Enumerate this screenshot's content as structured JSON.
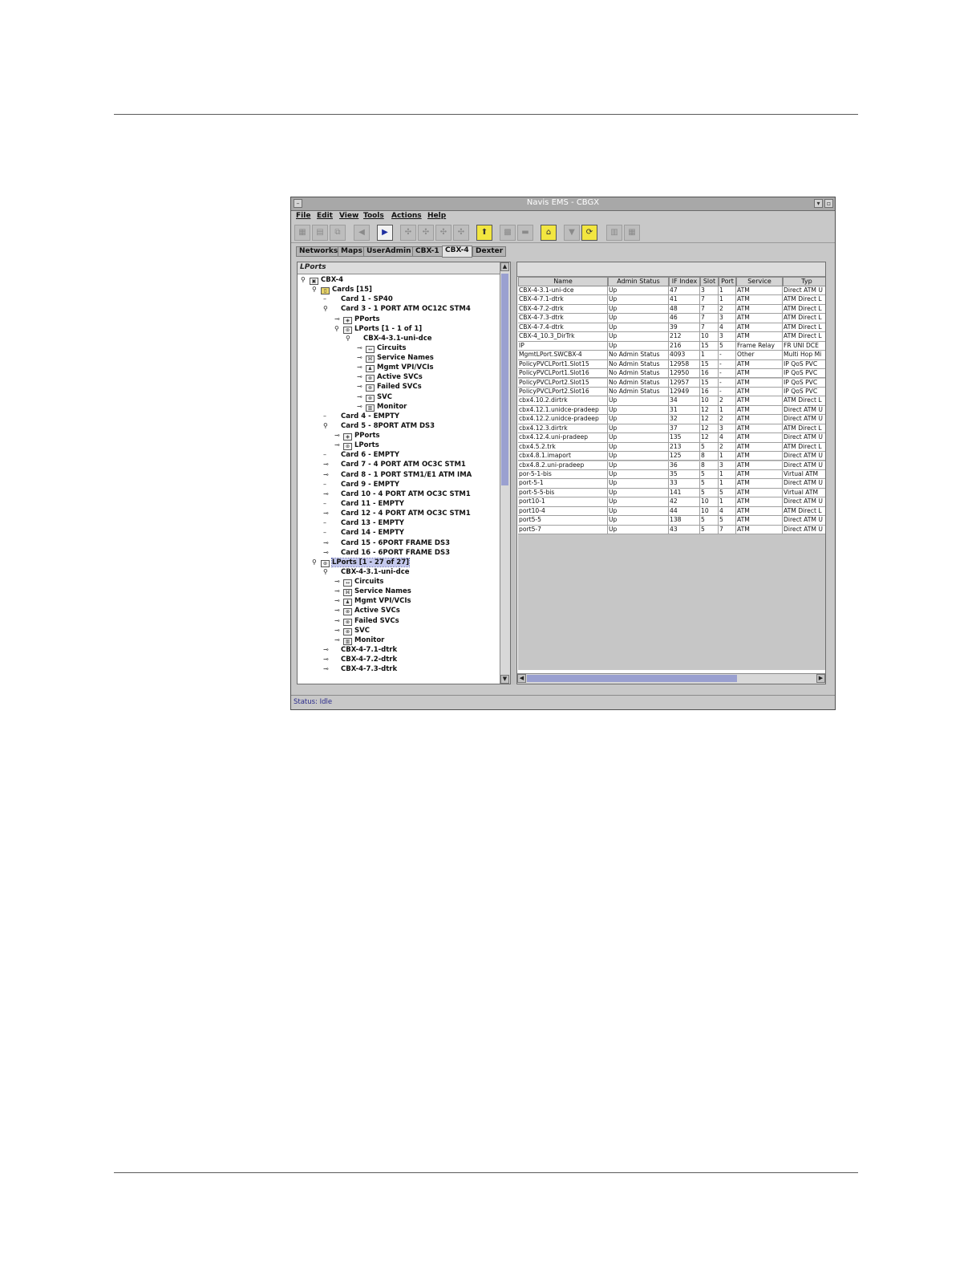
{
  "window": {
    "title": "Navis EMS - CBGX",
    "menu": [
      "File",
      "Edit",
      "View",
      "Tools",
      "Actions",
      "Help"
    ],
    "tabs": [
      "Networks",
      "Maps",
      "UserAdmin",
      "CBX-1",
      "CBX-4",
      "Dexter"
    ],
    "active_tab": "CBX-4",
    "status": "Status: Idle"
  },
  "tree": {
    "header": "LPorts",
    "nodes": [
      {
        "label": "CBX-4",
        "depth": 0,
        "exp": "⚲",
        "icon": "switch"
      },
      {
        "label": "Cards [15]",
        "depth": 1,
        "exp": "⚲",
        "icon": "card"
      },
      {
        "label": "Card 1 - SP40",
        "depth": 2,
        "exp": "–",
        "icon": "none"
      },
      {
        "label": "Card 3 - 1 PORT ATM OC12C STM4",
        "depth": 2,
        "exp": "⚲",
        "icon": "none"
      },
      {
        "label": "PPorts",
        "depth": 3,
        "exp": "⊸",
        "icon": "pport"
      },
      {
        "label": "LPorts [1 - 1 of 1]",
        "depth": 3,
        "exp": "⚲",
        "icon": "lport"
      },
      {
        "label": "CBX-4-3.1-uni-dce",
        "depth": 4,
        "exp": "⚲",
        "icon": "none"
      },
      {
        "label": "Circuits",
        "depth": 5,
        "exp": "⊸",
        "icon": "circuit"
      },
      {
        "label": "Service Names",
        "depth": 5,
        "exp": "⊸",
        "icon": "service"
      },
      {
        "label": "Mgmt VPI/VCIs",
        "depth": 5,
        "exp": "⊸",
        "icon": "mgmt"
      },
      {
        "label": "Active SVCs",
        "depth": 5,
        "exp": "⊸",
        "icon": "svc"
      },
      {
        "label": "Failed SVCs",
        "depth": 5,
        "exp": "⊸",
        "icon": "svc"
      },
      {
        "label": "SVC",
        "depth": 5,
        "exp": "⊸",
        "icon": "svc"
      },
      {
        "label": "Monitor",
        "depth": 5,
        "exp": "⊸",
        "icon": "monitor"
      },
      {
        "label": "Card 4 - EMPTY",
        "depth": 2,
        "exp": "–",
        "icon": "none"
      },
      {
        "label": "Card 5 - 8PORT ATM DS3",
        "depth": 2,
        "exp": "⚲",
        "icon": "none"
      },
      {
        "label": "PPorts",
        "depth": 3,
        "exp": "⊸",
        "icon": "pport"
      },
      {
        "label": "LPorts",
        "depth": 3,
        "exp": "⊸",
        "icon": "lport"
      },
      {
        "label": "Card 6 - EMPTY",
        "depth": 2,
        "exp": "–",
        "icon": "none"
      },
      {
        "label": "Card 7 - 4 PORT ATM OC3C STM1",
        "depth": 2,
        "exp": "⊸",
        "icon": "none"
      },
      {
        "label": "Card 8 - 1 PORT STM1/E1 ATM IMA",
        "depth": 2,
        "exp": "⊸",
        "icon": "none"
      },
      {
        "label": "Card 9 - EMPTY",
        "depth": 2,
        "exp": "–",
        "icon": "none"
      },
      {
        "label": "Card 10 - 4 PORT ATM OC3C STM1",
        "depth": 2,
        "exp": "⊸",
        "icon": "none"
      },
      {
        "label": "Card 11 - EMPTY",
        "depth": 2,
        "exp": "–",
        "icon": "none"
      },
      {
        "label": "Card 12 - 4 PORT ATM OC3C STM1",
        "depth": 2,
        "exp": "⊸",
        "icon": "none"
      },
      {
        "label": "Card 13 - EMPTY",
        "depth": 2,
        "exp": "–",
        "icon": "none"
      },
      {
        "label": "Card 14 - EMPTY",
        "depth": 2,
        "exp": "–",
        "icon": "none"
      },
      {
        "label": "Card 15 - 6PORT FRAME DS3",
        "depth": 2,
        "exp": "⊸",
        "icon": "none"
      },
      {
        "label": "Card 16 - 6PORT FRAME DS3",
        "depth": 2,
        "exp": "⊸",
        "icon": "none"
      },
      {
        "label": "LPorts [1 - 27 of 27]",
        "depth": 1,
        "exp": "⚲",
        "icon": "lport",
        "selected": true
      },
      {
        "label": "CBX-4-3.1-uni-dce",
        "depth": 2,
        "exp": "⚲",
        "icon": "none"
      },
      {
        "label": "Circuits",
        "depth": 3,
        "exp": "⊸",
        "icon": "circuit"
      },
      {
        "label": "Service Names",
        "depth": 3,
        "exp": "⊸",
        "icon": "service"
      },
      {
        "label": "Mgmt VPI/VCIs",
        "depth": 3,
        "exp": "⊸",
        "icon": "mgmt"
      },
      {
        "label": "Active SVCs",
        "depth": 3,
        "exp": "⊸",
        "icon": "svc"
      },
      {
        "label": "Failed SVCs",
        "depth": 3,
        "exp": "⊸",
        "icon": "svc"
      },
      {
        "label": "SVC",
        "depth": 3,
        "exp": "⊸",
        "icon": "svc"
      },
      {
        "label": "Monitor",
        "depth": 3,
        "exp": "⊸",
        "icon": "monitor"
      },
      {
        "label": "CBX-4-7.1-dtrk",
        "depth": 2,
        "exp": "⊸",
        "icon": "none"
      },
      {
        "label": "CBX-4-7.2-dtrk",
        "depth": 2,
        "exp": "⊸",
        "icon": "none"
      },
      {
        "label": "CBX-4-7.3-dtrk",
        "depth": 2,
        "exp": "⊸",
        "icon": "none"
      }
    ]
  },
  "table": {
    "columns": [
      "Name",
      "Admin Status",
      "IF Index",
      "Slot",
      "Port",
      "Service",
      "Typ"
    ],
    "rows": [
      [
        "CBX-4-3.1-uni-dce",
        "Up",
        "47",
        "3",
        "1",
        "ATM",
        "Direct ATM U"
      ],
      [
        "CBX-4-7.1-dtrk",
        "Up",
        "41",
        "7",
        "1",
        "ATM",
        "ATM Direct L"
      ],
      [
        "CBX-4-7.2-dtrk",
        "Up",
        "48",
        "7",
        "2",
        "ATM",
        "ATM Direct L"
      ],
      [
        "CBX-4-7.3-dtrk",
        "Up",
        "46",
        "7",
        "3",
        "ATM",
        "ATM Direct L"
      ],
      [
        "CBX-4-7.4-dtrk",
        "Up",
        "39",
        "7",
        "4",
        "ATM",
        "ATM Direct L"
      ],
      [
        "CBX-4_10.3_DirTrk",
        "Up",
        "212",
        "10",
        "3",
        "ATM",
        "ATM Direct L"
      ],
      [
        "IP",
        "Up",
        "216",
        "15",
        "5",
        "Frame Relay",
        "FR UNI DCE"
      ],
      [
        "MgmtLPort.SWCBX-4",
        "No Admin Status",
        "4093",
        "1",
        "-",
        "Other",
        "Multi Hop Mi"
      ],
      [
        "PolicyPVCLPort1.Slot15",
        "No Admin Status",
        "12958",
        "15",
        "-",
        "ATM",
        "IP QoS PVC"
      ],
      [
        "PolicyPVCLPort1.Slot16",
        "No Admin Status",
        "12950",
        "16",
        "-",
        "ATM",
        "IP QoS PVC"
      ],
      [
        "PolicyPVCLPort2.Slot15",
        "No Admin Status",
        "12957",
        "15",
        "-",
        "ATM",
        "IP QoS PVC"
      ],
      [
        "PolicyPVCLPort2.Slot16",
        "No Admin Status",
        "12949",
        "16",
        "-",
        "ATM",
        "IP QoS PVC"
      ],
      [
        "cbx4.10.2.dirtrk",
        "Up",
        "34",
        "10",
        "2",
        "ATM",
        "ATM Direct L"
      ],
      [
        "cbx4.12.1.unidce-pradeep",
        "Up",
        "31",
        "12",
        "1",
        "ATM",
        "Direct ATM U"
      ],
      [
        "cbx4.12.2.unidce-pradeep",
        "Up",
        "32",
        "12",
        "2",
        "ATM",
        "Direct ATM U"
      ],
      [
        "cbx4.12.3.dirtrk",
        "Up",
        "37",
        "12",
        "3",
        "ATM",
        "ATM Direct L"
      ],
      [
        "cbx4.12.4.uni-pradeep",
        "Up",
        "135",
        "12",
        "4",
        "ATM",
        "Direct ATM U"
      ],
      [
        "cbx4.5.2.trk",
        "Up",
        "213",
        "5",
        "2",
        "ATM",
        "ATM Direct L"
      ],
      [
        "cbx4.8.1.imaport",
        "Up",
        "125",
        "8",
        "1",
        "ATM",
        "Direct ATM U"
      ],
      [
        "cbx4.8.2.uni-pradeep",
        "Up",
        "36",
        "8",
        "3",
        "ATM",
        "Direct ATM U"
      ],
      [
        "por-5-1-bis",
        "Up",
        "35",
        "5",
        "1",
        "ATM",
        "Virtual ATM"
      ],
      [
        "port-5-1",
        "Up",
        "33",
        "5",
        "1",
        "ATM",
        "Direct ATM U"
      ],
      [
        "port-5-5-bis",
        "Up",
        "141",
        "5",
        "5",
        "ATM",
        "Virtual ATM"
      ],
      [
        "port10-1",
        "Up",
        "42",
        "10",
        "1",
        "ATM",
        "Direct ATM U"
      ],
      [
        "port10-4",
        "Up",
        "44",
        "10",
        "4",
        "ATM",
        "ATM Direct L"
      ],
      [
        "port5-5",
        "Up",
        "138",
        "5",
        "5",
        "ATM",
        "Direct ATM U"
      ],
      [
        "port5-7",
        "Up",
        "43",
        "5",
        "7",
        "ATM",
        "Direct ATM U"
      ]
    ]
  }
}
